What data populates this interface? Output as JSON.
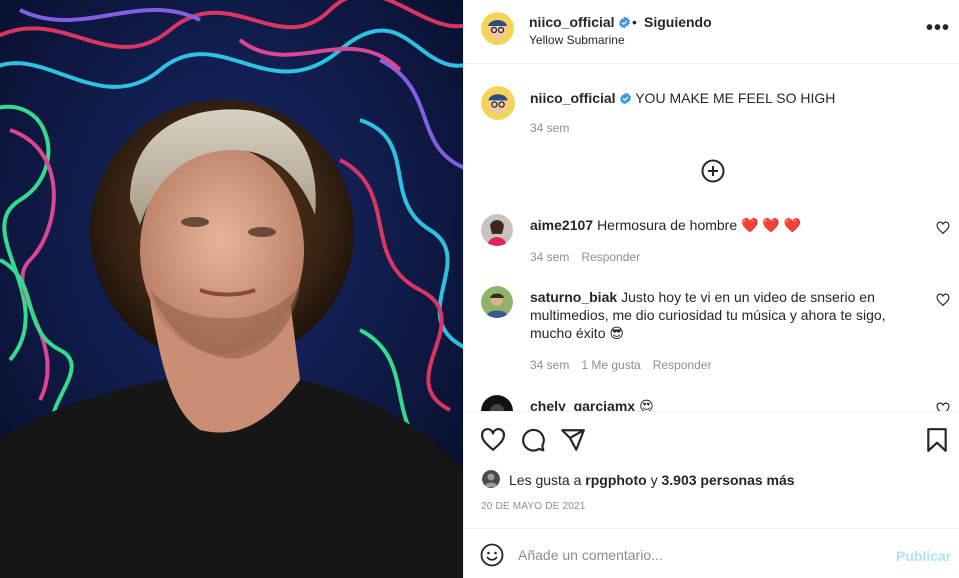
{
  "post": {
    "username": "niico_official",
    "separator": "•",
    "follow_status": "Siguiendo",
    "song": "Yellow Submarine",
    "more_icon": "more-horizontal-icon",
    "more_label": "•••"
  },
  "caption": {
    "username": "niico_official",
    "text": "YOU MAKE ME FEEL SO HIGH",
    "time": "34 sem"
  },
  "load_more_icon": "plus-circle-icon",
  "comments": [
    {
      "username": "aime2107",
      "text": "Hermosura de hombre ❤️ ❤️ ❤️",
      "time": "34 sem",
      "likes": "",
      "reply": "Responder"
    },
    {
      "username": "saturno_biak",
      "text": "Justo hoy te vi en un video de snserio en multimedios, me dio curiosidad tu música y ahora te sigo, mucho éxito 😎",
      "time": "34 sem",
      "likes": "1 Me gusta",
      "reply": "Responder"
    },
    {
      "username": "chely_garciamx",
      "text": "😍",
      "time": "",
      "likes": "",
      "reply": ""
    }
  ],
  "actions": {
    "like_icon": "heart-icon",
    "comment_icon": "comment-icon",
    "share_icon": "send-icon",
    "save_icon": "bookmark-icon"
  },
  "likes": {
    "prefix": "Les gusta a",
    "user": "rpgphoto",
    "middle": "y",
    "others": "3.903 personas más"
  },
  "date": "20 DE MAYO DE 2021",
  "composer": {
    "placeholder": "Añade un comentario...",
    "publish": "Publicar",
    "emoji_icon": "smiley-icon"
  },
  "colors": {
    "verified": "#3897f0",
    "heart_red": "#e0245e",
    "publish_disabled": "#b2dffc",
    "muted_text": "#8e8e8e"
  }
}
